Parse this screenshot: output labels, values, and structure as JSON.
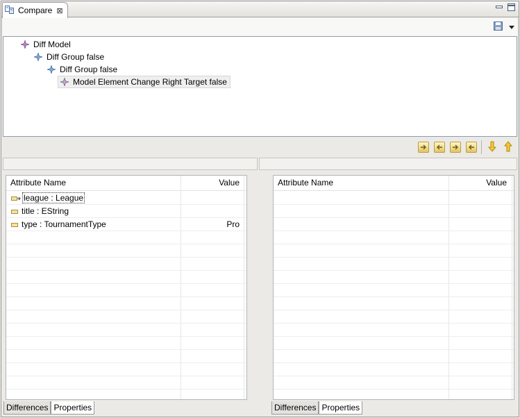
{
  "view_tab": {
    "title": "Compare",
    "close": "⊠"
  },
  "tree": {
    "nodes": [
      {
        "label": "Diff Model",
        "icon": "diff-model-icon",
        "depth": 0
      },
      {
        "label": "Diff Group false",
        "icon": "diff-group-icon",
        "depth": 1
      },
      {
        "label": "Diff Group false",
        "icon": "diff-group-icon",
        "depth": 2
      },
      {
        "label": "Model Element Change Right Target false",
        "icon": "model-element-change-icon",
        "depth": 3
      }
    ]
  },
  "left_table": {
    "headers": {
      "name": "Attribute Name",
      "value": "Value"
    },
    "rows": [
      {
        "name": "league : League",
        "value": "",
        "icon": "reference-icon"
      },
      {
        "name": "title : EString",
        "value": "",
        "icon": "attribute-icon"
      },
      {
        "name": "type : TournamentType",
        "value": "Pro",
        "icon": "attribute-icon"
      }
    ],
    "tabs": [
      "Differences",
      "Properties"
    ]
  },
  "right_table": {
    "headers": {
      "name": "Attribute Name",
      "value": "Value"
    },
    "rows": [],
    "tabs": [
      "Differences",
      "Properties"
    ]
  }
}
